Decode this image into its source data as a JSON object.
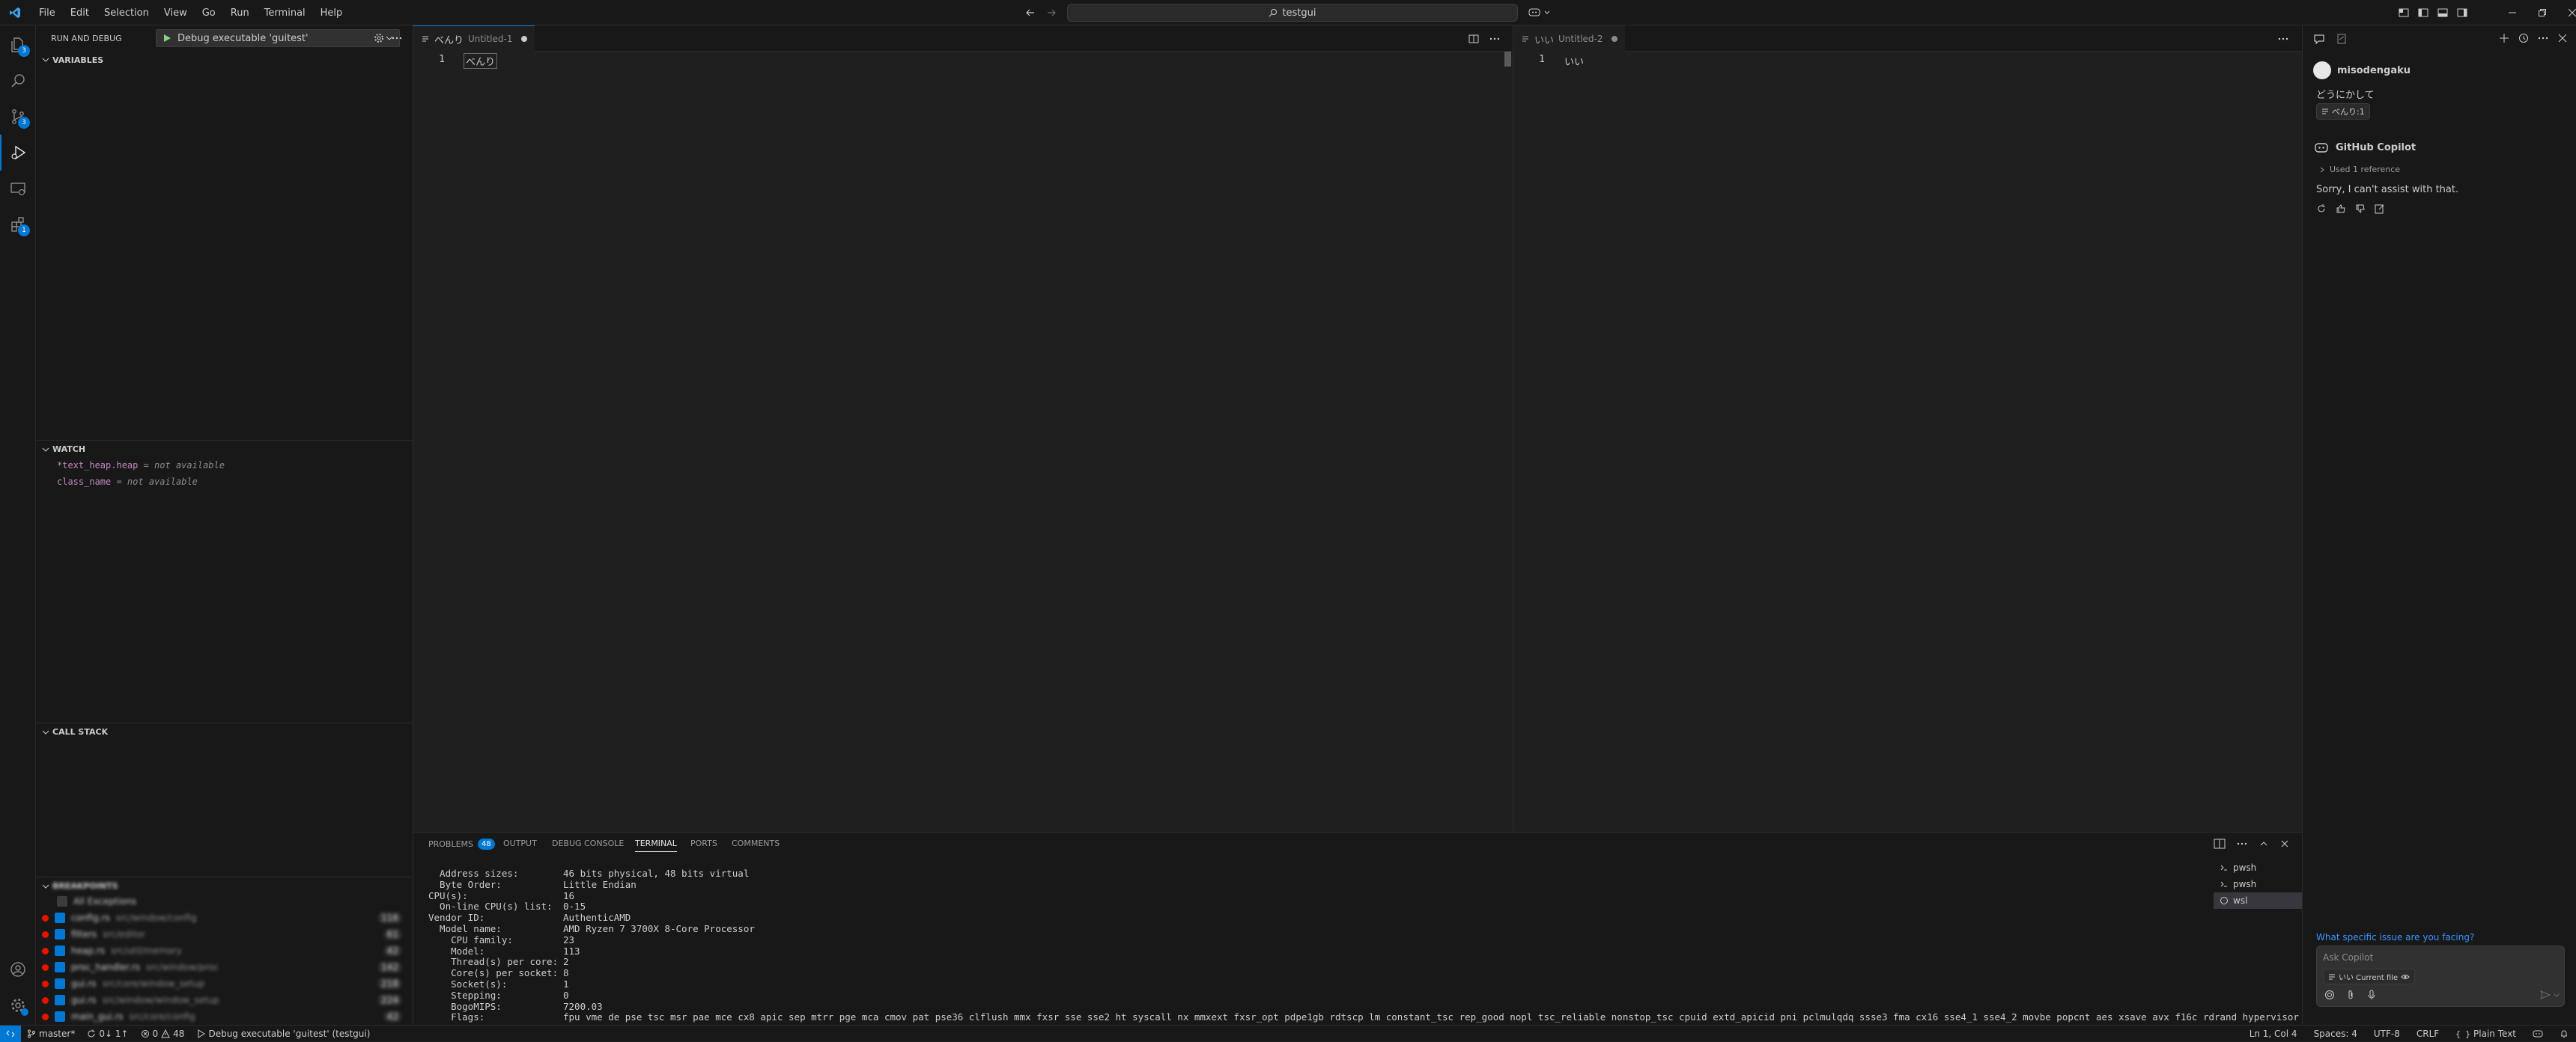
{
  "menu": [
    "File",
    "Edit",
    "Selection",
    "View",
    "Go",
    "Run",
    "Terminal",
    "Help"
  ],
  "search": {
    "text": "testgui"
  },
  "activity": {
    "explorer_badge": "3",
    "scm_badge": "3",
    "extensions_badge": "1"
  },
  "sidebar": {
    "title": "RUN AND DEBUG",
    "config": "Debug executable 'guitest'",
    "variables_header": "VARIABLES",
    "watch_header": "WATCH",
    "watch": [
      {
        "name": "*text_heap.heap",
        "value": "= not available"
      },
      {
        "name": "class_name",
        "value": "= not available"
      }
    ],
    "callstack_header": "CALL STACK",
    "breakpoints_header": "BREAKPOINTS",
    "breakpoints": [
      {
        "label": "All Exceptions"
      },
      {
        "label": "config.rs",
        "path": "src/window/config",
        "line": "116"
      },
      {
        "label": "filters",
        "path": "src/editor",
        "line": "61"
      },
      {
        "label": "heap.rs",
        "path": "src/util/memory",
        "line": "42"
      },
      {
        "label": "proc_handler.rs",
        "path": "src/window/proc",
        "line": "142"
      },
      {
        "label": "gui.rs",
        "path": "src/core/window_setup",
        "line": "218"
      },
      {
        "label": "gui.rs",
        "path": "src/window/window_setup",
        "line": "224"
      },
      {
        "label": "main_gui.rs",
        "path": "src/core/config",
        "line": "42"
      }
    ]
  },
  "editor1": {
    "tab_label": "べんり",
    "tab_desc": "Untitled-1",
    "lines": [
      {
        "num": "1",
        "text": "べんり"
      }
    ]
  },
  "editor2": {
    "tab_label": "いい",
    "tab_desc": "Untitled-2",
    "lines": [
      {
        "num": "1",
        "text": "いい"
      }
    ]
  },
  "panel": {
    "tabs": [
      "PROBLEMS",
      "OUTPUT",
      "DEBUG CONSOLE",
      "TERMINAL",
      "PORTS",
      "COMMENTS"
    ],
    "problems_count": "48",
    "terminal_lines": [
      {
        "k": "  Address sizes:",
        "v": "46 bits physical, 48 bits virtual"
      },
      {
        "k": "  Byte Order:",
        "v": "Little Endian"
      },
      {
        "k": "CPU(s):",
        "v": "16"
      },
      {
        "k": "  On-line CPU(s) list:",
        "v": "0-15"
      },
      {
        "k": "Vendor ID:",
        "v": "AuthenticAMD"
      },
      {
        "k": "  Model name:",
        "v": "AMD Ryzen 7 3700X 8-Core Processor"
      },
      {
        "k": "    CPU family:",
        "v": "23"
      },
      {
        "k": "    Model:",
        "v": "113"
      },
      {
        "k": "    Thread(s) per core:",
        "v": "2"
      },
      {
        "k": "    Core(s) per socket:",
        "v": "8"
      },
      {
        "k": "    Socket(s):",
        "v": "1"
      },
      {
        "k": "    Stepping:",
        "v": "0"
      },
      {
        "k": "    BogoMIPS:",
        "v": "7200.03"
      },
      {
        "k": "    Flags:",
        "v": "fpu vme de pse tsc msr pae mce cx8 apic sep mtrr pge mca cmov pat pse36 clflush mmx fxsr sse sse2 ht syscall nx mmxext fxsr_opt pdpe1gb rdtscp lm constant_tsc rep_good nopl tsc_reliable nonstop_tsc cpuid extd_apicid pni pclmulqdq ssse3 fma cx16 sse4_1 sse4_2 movbe popcnt aes xsave avx f16c rdrand hypervisor lah"
      }
    ],
    "terminals": [
      "pwsh",
      "pwsh",
      "wsl"
    ]
  },
  "chat": {
    "user": "misodengaku",
    "user_msg": "どうにかして",
    "ref_chip": "べんり:1",
    "bot": "GitHub Copilot",
    "used_ref": "Used 1 reference",
    "bot_msg": "Sorry, I can't assist with that.",
    "suggestion": "What specific issue are you facing?",
    "input_placeholder": "Ask Copilot",
    "context_chip": "いい Current file"
  },
  "status": {
    "branch": "master*",
    "sync": "0↓ 1↑",
    "errors": "0",
    "warnings": "48",
    "debug": "Debug executable 'guitest' (testgui)",
    "position": "Ln 1, Col 4",
    "spaces": "Spaces: 4",
    "encoding": "UTF-8",
    "eol": "CRLF",
    "language": "Plain Text"
  },
  "colors": {
    "accent": "#0078d4",
    "breakpoint": "#e51400",
    "background": "#1f1f1f",
    "chrome": "#181818"
  }
}
